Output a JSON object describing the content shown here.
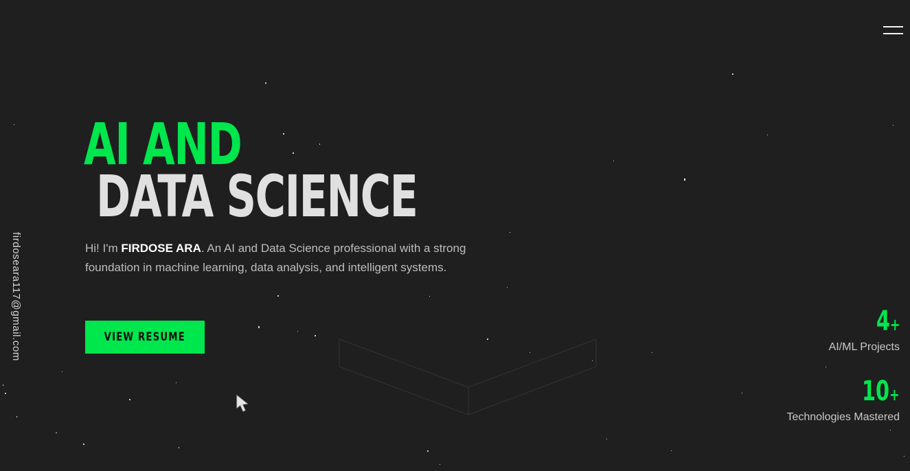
{
  "header": {
    "menu_icon": "hamburger-menu-icon"
  },
  "sidebar": {
    "email": "firdoseara117@gmail.com"
  },
  "hero": {
    "title_line1": "AI AND",
    "title_line2": "DATA SCIENCE",
    "intro_prefix": "Hi! I'm ",
    "intro_name": "FIRDOSE ARA",
    "intro_suffix": ". An AI and Data Science professional with a strong foundation in machine learning, data analysis, and intelligent systems.",
    "resume_label": "VIEW RESUME"
  },
  "stats": [
    {
      "value": "4",
      "suffix": "+",
      "label": "AI/ML Projects"
    },
    {
      "value": "10",
      "suffix": "+",
      "label": "Technologies Mastered"
    }
  ],
  "colors": {
    "background": "#1f1f1f",
    "accent": "#00e64d",
    "title_secondary": "#e0e0e0",
    "body_text": "#bdbdbd"
  }
}
